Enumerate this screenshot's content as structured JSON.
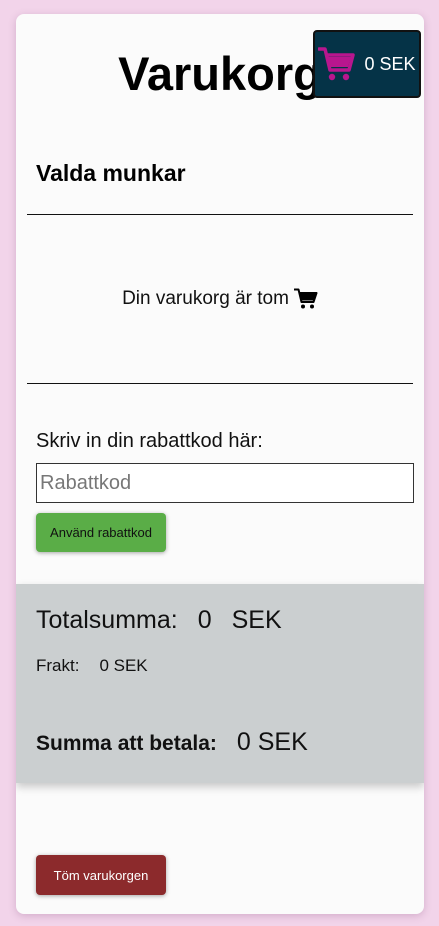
{
  "page": {
    "title": "Varukorg"
  },
  "cart_button": {
    "icon": "shopping-cart-icon",
    "icon_color": "#b8168e",
    "total": "0 SEK"
  },
  "selected": {
    "heading": "Valda munkar"
  },
  "empty_state": {
    "text": "Din varukorg är tom",
    "icon": "shopping-cart-icon"
  },
  "discount": {
    "label": "Skriv in din rabattkod här:",
    "placeholder": "Rabattkod",
    "value": "",
    "button_label": "Använd rabattkod"
  },
  "summary": {
    "total_label": "Totalsumma:",
    "total_value": "0",
    "total_currency": "SEK",
    "freight_label": "Frakt:",
    "freight_value": "0 SEK",
    "pay_label": "Summa att betala:",
    "pay_value": "0 SEK"
  },
  "clear_button": {
    "label": "Töm varukorgen"
  },
  "colors": {
    "background": "#f2d4ea",
    "cart_button_bg": "#053347",
    "apply_button": "#5aad47",
    "clear_button": "#8c2a2c",
    "summary_bg": "#cbcfd0"
  }
}
